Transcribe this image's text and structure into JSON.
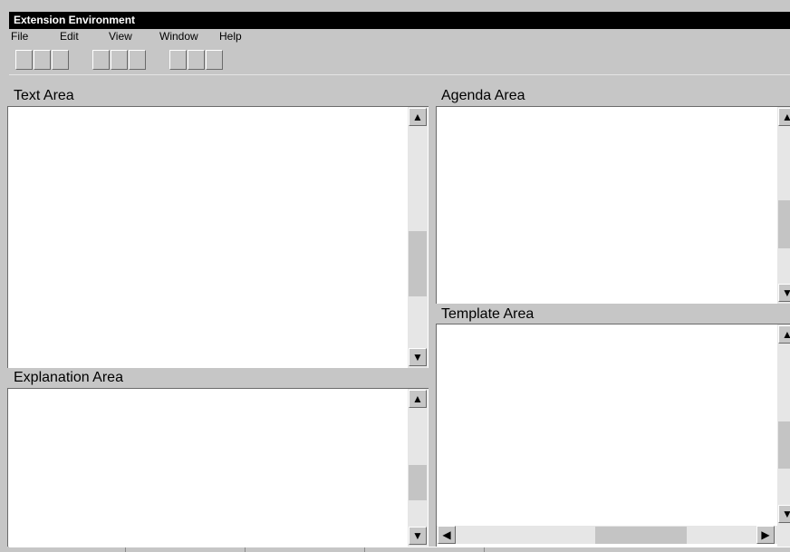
{
  "window": {
    "title": "Extension Environment"
  },
  "menu": {
    "file": "File",
    "edit": "Edit",
    "view": "View",
    "window": "Window",
    "help": "Help"
  },
  "panes": {
    "text": {
      "label": "Text Area"
    },
    "agenda": {
      "label": "Agenda Area"
    },
    "explanation": {
      "label": "Explanation Area"
    },
    "template": {
      "label": "Template Area"
    }
  },
  "icons": {
    "scroll_up": "▲",
    "scroll_down": "▼",
    "scroll_left": "◀",
    "scroll_right": "▶"
  }
}
